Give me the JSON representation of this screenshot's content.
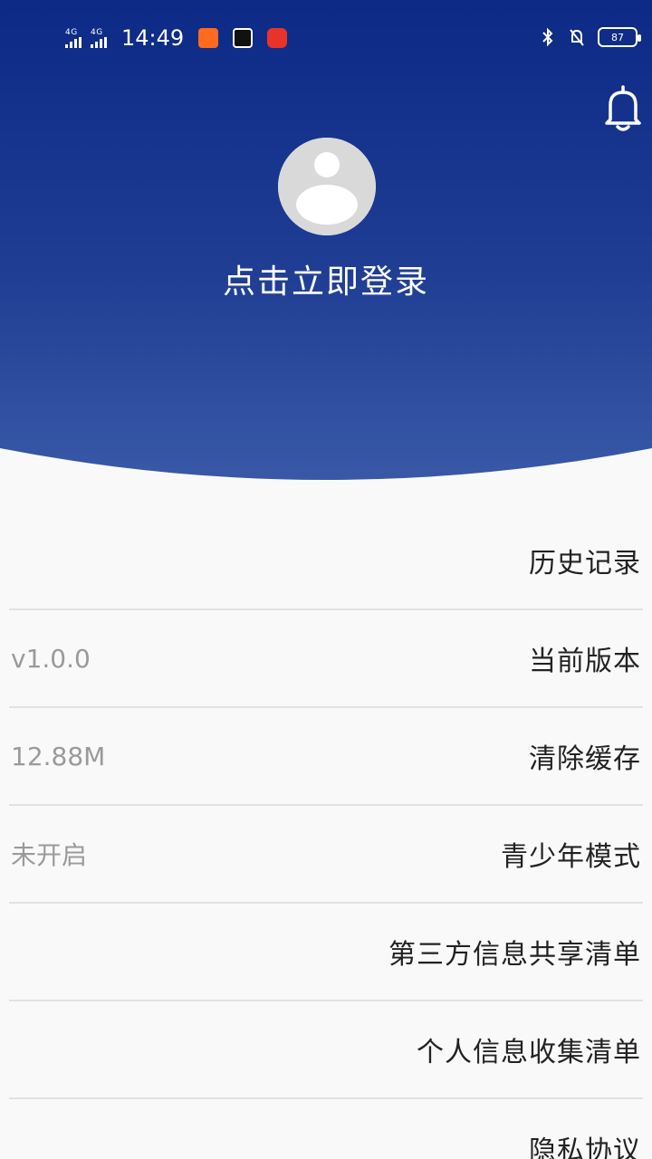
{
  "status_bar": {
    "network_1": "4G",
    "network_2": "4G",
    "time": "14:49",
    "battery": "87"
  },
  "header": {
    "login_text": "点击立即登录"
  },
  "menu": {
    "items": [
      {
        "label": "历史记录",
        "value": ""
      },
      {
        "label": "当前版本",
        "value": "v1.0.0"
      },
      {
        "label": "清除缓存",
        "value": "12.88M"
      },
      {
        "label": "青少年模式",
        "value": "未开启"
      },
      {
        "label": "第三方信息共享清单",
        "value": ""
      },
      {
        "label": "个人信息收集清单",
        "value": ""
      },
      {
        "label": "隐私协议",
        "value": ""
      }
    ]
  },
  "colors": {
    "header_top": "#0c2a86",
    "header_bottom": "#3a5aa8",
    "page_background": "#f9f9f9"
  }
}
